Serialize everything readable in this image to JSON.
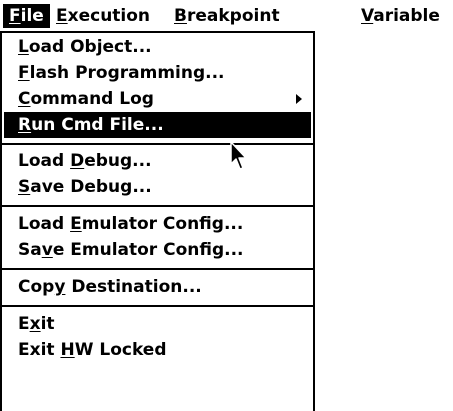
{
  "menubar": {
    "items": [
      {
        "label": "File",
        "mnemonic": "F",
        "rest": "ile",
        "active": true
      },
      {
        "label": "Execution",
        "mnemonic": "E",
        "rest": "xecution"
      },
      {
        "label": "Breakpoint",
        "mnemonic": "B",
        "rest": "reakpoint"
      },
      {
        "label": "Variable",
        "mnemonic": "V",
        "rest": "ariable"
      }
    ]
  },
  "file_menu": {
    "items": [
      {
        "label": "Load Object...",
        "pre": "",
        "mnemonic": "L",
        "post": "oad Object..."
      },
      {
        "label": "Flash Programming...",
        "pre": "",
        "mnemonic": "F",
        "post": "lash Programming..."
      },
      {
        "label": "Command Log",
        "pre": "",
        "mnemonic": "C",
        "post": "ommand Log",
        "submenu": true
      },
      {
        "label": "Run Cmd File...",
        "pre": "",
        "mnemonic": "R",
        "post": "un Cmd File...",
        "selected": true
      },
      {
        "label": "Load Debug...",
        "pre": "Load ",
        "mnemonic": "D",
        "post": "ebug..."
      },
      {
        "label": "Save Debug...",
        "pre": "",
        "mnemonic": "S",
        "post": "ave Debug..."
      },
      {
        "label": "Load Emulator Config...",
        "pre": "Load ",
        "mnemonic": "E",
        "post": "mulator Config..."
      },
      {
        "label": "Save Emulator Config...",
        "pre": "Sa",
        "mnemonic": "v",
        "post": "e Emulator Config..."
      },
      {
        "label": "Copy Destination...",
        "pre": "Cop",
        "mnemonic": "y",
        "post": " Destination..."
      },
      {
        "label": "Exit",
        "pre": "E",
        "mnemonic": "x",
        "post": "it"
      },
      {
        "label": "Exit HW Locked",
        "pre": "Exit ",
        "mnemonic": "H",
        "post": "W Locked"
      }
    ]
  },
  "colors": {
    "highlight_bg": "#000000",
    "highlight_fg": "#ffffff",
    "menu_bg": "#ffffff"
  },
  "cursor": {
    "icon": "arrow-pointer-icon"
  }
}
